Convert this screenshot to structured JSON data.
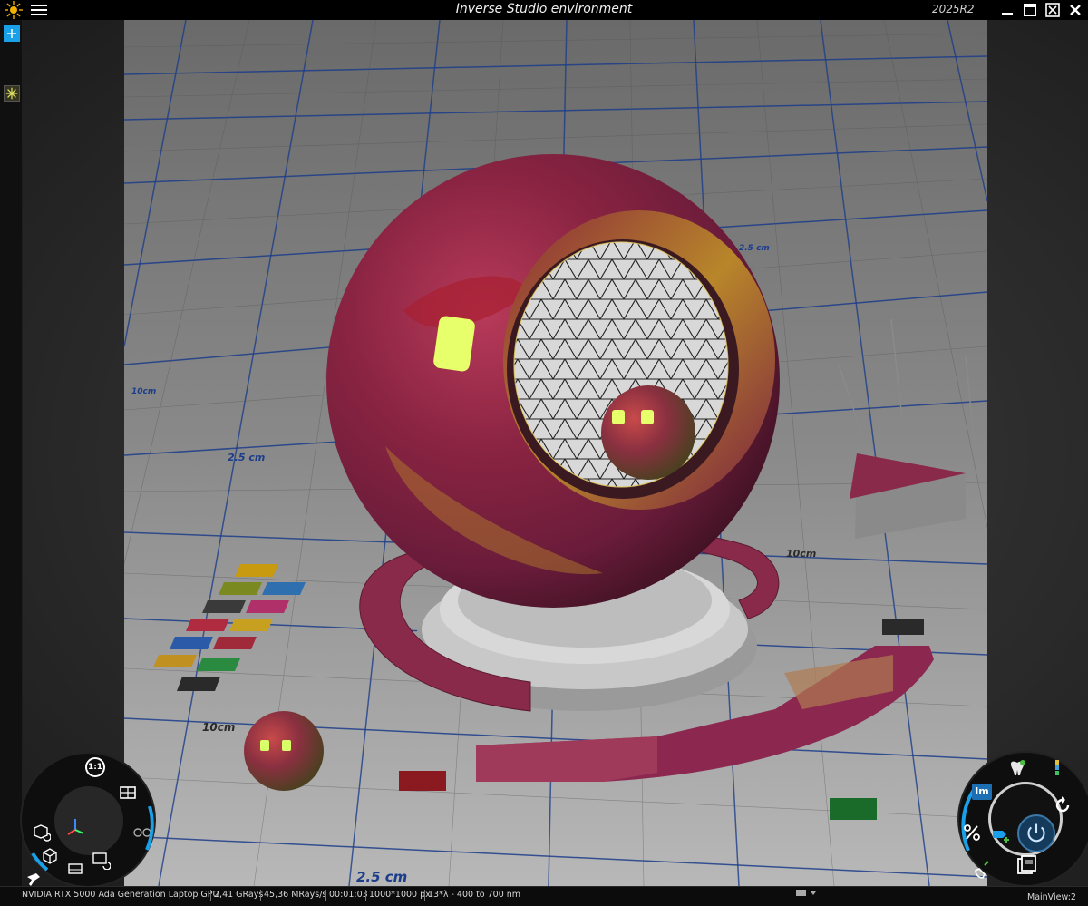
{
  "window": {
    "title": "Inverse Studio environment",
    "version": "2025R2"
  },
  "icons": {
    "logo": "sun-logo-icon",
    "menu": "hamburger-menu-icon",
    "minimize": "minimize-icon",
    "maximize": "maximize-icon",
    "fullscreen": "fullscreen-icon",
    "close": "close-icon"
  },
  "scene": {
    "floor_labels": [
      "10cm",
      "2.5 cm",
      "10cm",
      "2.5 cm",
      "10cm",
      "2.5 cm"
    ],
    "colors": {
      "sphere_body": "#8a2a4a",
      "sphere_gold": "#b8862a",
      "floor_tile": "#9c9c9c",
      "grid_line": "#1c3d8a",
      "highlight": "#e6ff6a"
    },
    "swatches": [
      "#c79a10",
      "#7a8a20",
      "#2e6fb0",
      "#3a3a3a",
      "#b0306a",
      "#b02a40",
      "#c8a020",
      "#2a5aa8",
      "#a02a3a",
      "#c09020",
      "#2a8a40",
      "#2a2a2a"
    ]
  },
  "nav_wheel": {
    "zoom_label": "1:1"
  },
  "control_wheel": {
    "im_label": "Im"
  },
  "status": {
    "gpu": "NVIDIA RTX 5000 Ada Generation Laptop GPU",
    "grays": "2,41 GRays",
    "mrays": "45,36 MRays/s",
    "time": "00:01:03",
    "resolution": "1000*1000 px",
    "spectral": "13*λ - 400 to 700 nm",
    "view": "MainView:2"
  }
}
